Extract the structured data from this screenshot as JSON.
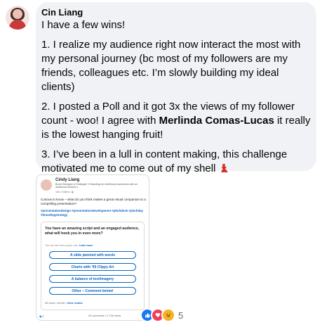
{
  "comment": {
    "author": "Cin Liang",
    "intro": "I have a few wins!",
    "p1": "1. I realize my audience right now interact the most with my personal journey (bc most of my followers are my friends, colleagues etc. I’m slowly building my ideal clients)",
    "p2_before": "2. I posted a Poll and it got 3x the views of my follower count - woo! I agree with ",
    "p2_mention": "Merlinda Comas-Lucas",
    "p2_after": " it really is the lowest hanging fruit!",
    "p3": "3. I’ve been in a lull in content making, this challenge motivated me to come out of my shell ",
    "dress_icon": "dress-icon",
    "reaction_count": "5",
    "reaction_icons": [
      "like-icon",
      "love-icon",
      "haha-icon"
    ]
  },
  "attachment": {
    "name": "Cindy Liang",
    "subtitle": "Brand Designer & Strategist ✦ Branding for rebellious businesses with an audacious mission t...",
    "meta": "16h • Edited • ◉",
    "question": "Curious to know – what do you think makes a great visual companion to a compelling presentation?",
    "hashtags": "#presentationdesign #presentationdevelopment #pitchdeck #pitchday #brandingstrategy",
    "poll": {
      "question": "You have an amazing script and an engaged audience, what will hook you in even more?",
      "hint": "You can see how people vote.",
      "learn_more": "Learn more",
      "options": [
        "A slide jammed with words",
        "Charts with ’99 Clippy Art",
        "A balance of text/imagery",
        "Other – Comment below!"
      ],
      "votes": "36 votes • 6d left •",
      "view_results": "View results"
    },
    "likes": "4",
    "stats": "20 comments • 2,748 views"
  },
  "colors": {
    "bubble_bg": "#f0f2f5",
    "linkedin_blue": "#0a66c2",
    "like": "#1877f2",
    "love": "#f33e58",
    "haha": "#f7b125"
  }
}
